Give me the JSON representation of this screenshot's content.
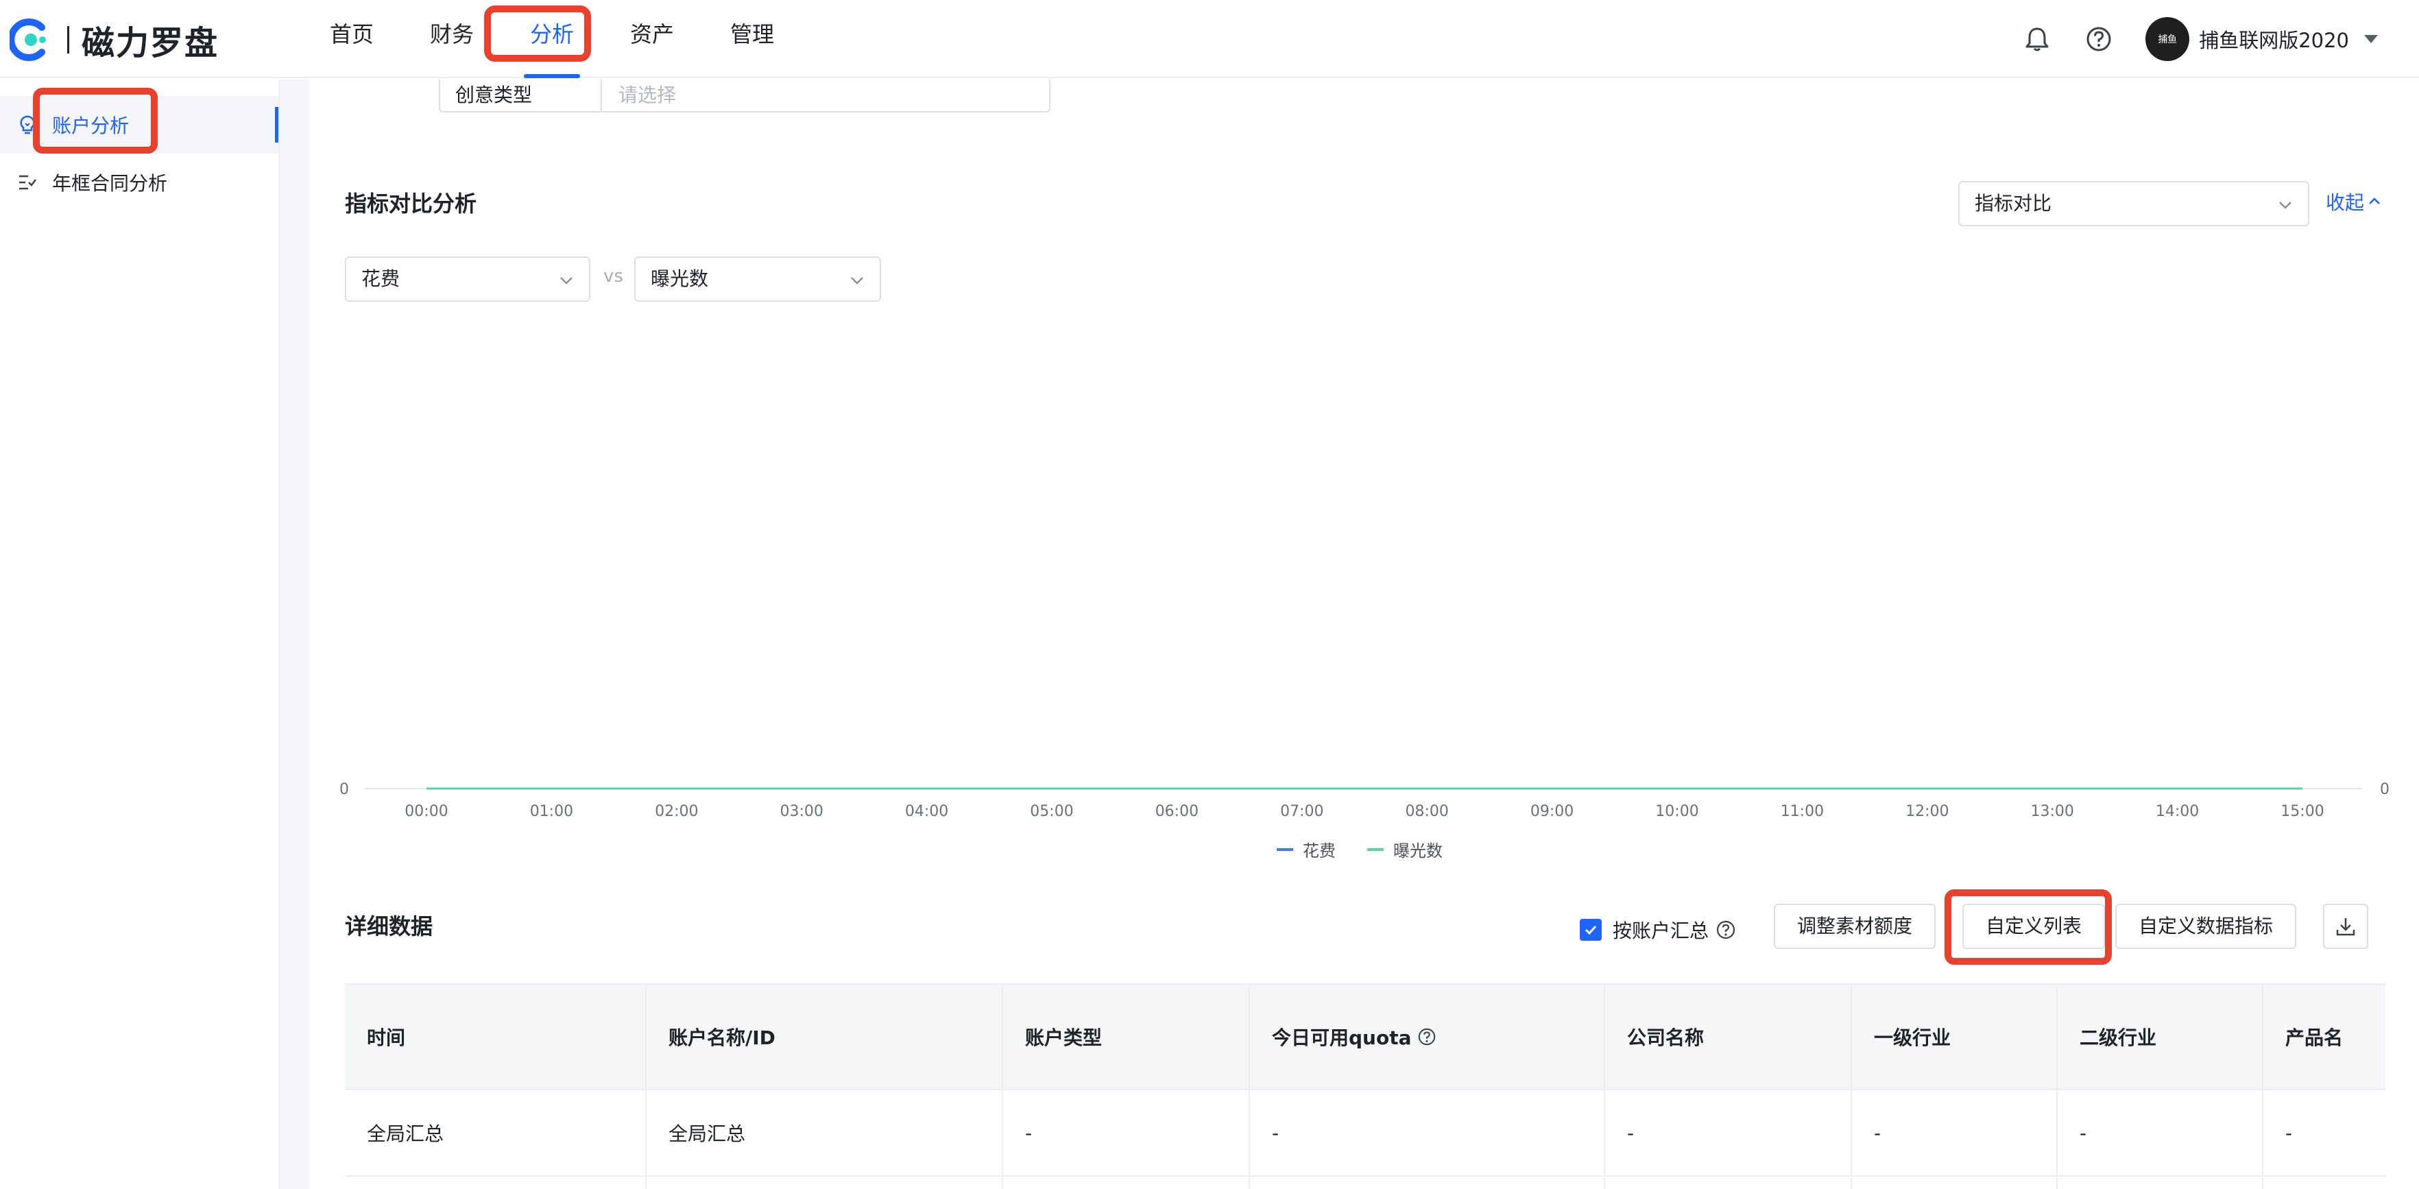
{
  "app": {
    "logo_text": "磁力罗盘",
    "nav": [
      "首页",
      "财务",
      "分析",
      "资产",
      "管理"
    ],
    "active_nav": "分析",
    "user_name": "捕鱼联网版2020",
    "avatar_text": "捕鱼"
  },
  "sidebar": {
    "items": [
      {
        "label": "账户分析",
        "icon": "lightbulb-icon",
        "active": true
      },
      {
        "label": "年框合同分析",
        "icon": "list-check-icon",
        "active": false
      }
    ]
  },
  "filters": {
    "creative_type_label": "创意类型",
    "creative_type_placeholder": "请选择"
  },
  "metric_section": {
    "title": "指标对比分析",
    "compare_select": "指标对比",
    "collapse_label": "收起",
    "metric_a": "花费",
    "vs": "vs",
    "metric_b": "曝光数"
  },
  "chart_data": {
    "type": "line",
    "x": [
      "00:00",
      "01:00",
      "02:00",
      "03:00",
      "04:00",
      "05:00",
      "06:00",
      "07:00",
      "08:00",
      "09:00",
      "10:00",
      "11:00",
      "12:00",
      "13:00",
      "14:00",
      "15:00"
    ],
    "series": [
      {
        "name": "花费",
        "values": [
          0,
          0,
          0,
          0,
          0,
          0,
          0,
          0,
          0,
          0,
          0,
          0,
          0,
          0,
          0,
          0
        ],
        "color": "#3b7cf6",
        "axis": "left"
      },
      {
        "name": "曝光数",
        "values": [
          0,
          0,
          0,
          0,
          0,
          0,
          0,
          0,
          0,
          0,
          0,
          0,
          0,
          0,
          0,
          0
        ],
        "color": "#56d1a8",
        "axis": "right"
      }
    ],
    "y_left_ticks": [
      "0"
    ],
    "y_right_ticks": [
      "0"
    ],
    "legend_position": "bottom-center",
    "grid": false
  },
  "detail": {
    "title": "详细数据",
    "aggregate_label": "按账户汇总",
    "aggregate_checked": true,
    "buttons": [
      "调整素材额度",
      "自定义列表",
      "自定义数据指标"
    ],
    "columns": [
      "时间",
      "账户名称/ID",
      "账户类型",
      "今日可用quota",
      "公司名称",
      "一级行业",
      "二级行业",
      "产品名"
    ],
    "rows": [
      [
        "全局汇总",
        "全局汇总",
        "-",
        "-",
        "-",
        "-",
        "-",
        "-"
      ]
    ]
  },
  "colors": {
    "primary": "#1e64fa",
    "highlight": "#e8412e"
  }
}
